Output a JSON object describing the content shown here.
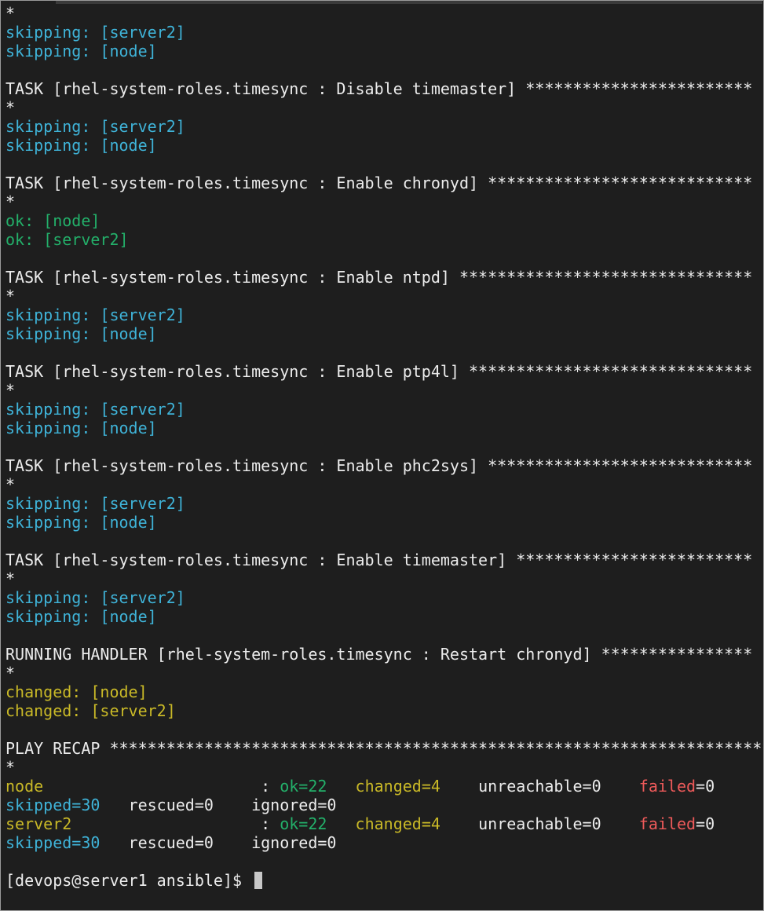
{
  "terminal": {
    "lines": [
      [
        {
          "t": "*",
          "c": "white"
        }
      ],
      [
        {
          "t": "skipping: [server2]",
          "c": "cyan"
        }
      ],
      [
        {
          "t": "skipping: [node]",
          "c": "cyan"
        }
      ],
      [],
      [
        {
          "t": "TASK [rhel-system-roles.timesync : Disable timemaster] ************************",
          "c": "white"
        }
      ],
      [
        {
          "t": "*",
          "c": "white"
        }
      ],
      [
        {
          "t": "skipping: [server2]",
          "c": "cyan"
        }
      ],
      [
        {
          "t": "skipping: [node]",
          "c": "cyan"
        }
      ],
      [],
      [
        {
          "t": "TASK [rhel-system-roles.timesync : Enable chronyd] ****************************",
          "c": "white"
        }
      ],
      [
        {
          "t": "*",
          "c": "white"
        }
      ],
      [
        {
          "t": "ok: [node]",
          "c": "green"
        }
      ],
      [
        {
          "t": "ok: [server2]",
          "c": "green"
        }
      ],
      [],
      [
        {
          "t": "TASK [rhel-system-roles.timesync : Enable ntpd] *******************************",
          "c": "white"
        }
      ],
      [
        {
          "t": "*",
          "c": "white"
        }
      ],
      [
        {
          "t": "skipping: [server2]",
          "c": "cyan"
        }
      ],
      [
        {
          "t": "skipping: [node]",
          "c": "cyan"
        }
      ],
      [],
      [
        {
          "t": "TASK [rhel-system-roles.timesync : Enable ptp4l] ******************************",
          "c": "white"
        }
      ],
      [
        {
          "t": "*",
          "c": "white"
        }
      ],
      [
        {
          "t": "skipping: [server2]",
          "c": "cyan"
        }
      ],
      [
        {
          "t": "skipping: [node]",
          "c": "cyan"
        }
      ],
      [],
      [
        {
          "t": "TASK [rhel-system-roles.timesync : Enable phc2sys] ****************************",
          "c": "white"
        }
      ],
      [
        {
          "t": "*",
          "c": "white"
        }
      ],
      [
        {
          "t": "skipping: [server2]",
          "c": "cyan"
        }
      ],
      [
        {
          "t": "skipping: [node]",
          "c": "cyan"
        }
      ],
      [],
      [
        {
          "t": "TASK [rhel-system-roles.timesync : Enable timemaster] *************************",
          "c": "white"
        }
      ],
      [
        {
          "t": "*",
          "c": "white"
        }
      ],
      [
        {
          "t": "skipping: [server2]",
          "c": "cyan"
        }
      ],
      [
        {
          "t": "skipping: [node]",
          "c": "cyan"
        }
      ],
      [],
      [
        {
          "t": "RUNNING HANDLER [rhel-system-roles.timesync : Restart chronyd] ****************",
          "c": "white"
        }
      ],
      [
        {
          "t": "*",
          "c": "white"
        }
      ],
      [
        {
          "t": "changed: [node]",
          "c": "yellow"
        }
      ],
      [
        {
          "t": "changed: [server2]",
          "c": "yellow"
        }
      ],
      [],
      [
        {
          "t": "PLAY RECAP **********************************************************************",
          "c": "white"
        }
      ],
      [
        {
          "t": "*",
          "c": "white"
        }
      ],
      [
        {
          "t": "node",
          "c": "yellow"
        },
        {
          "t": "                       : ",
          "c": "white"
        },
        {
          "t": "ok=22",
          "c": "green"
        },
        {
          "t": "   ",
          "c": "white"
        },
        {
          "t": "changed=4",
          "c": "yellow"
        },
        {
          "t": "    unreachable=0    ",
          "c": "white"
        },
        {
          "t": "failed",
          "c": "red"
        },
        {
          "t": "=0",
          "c": "white"
        }
      ],
      [
        {
          "t": "skipped=30",
          "c": "cyan"
        },
        {
          "t": "   rescued=0    ignored=0",
          "c": "white"
        }
      ],
      [
        {
          "t": "server2",
          "c": "yellow"
        },
        {
          "t": "                    : ",
          "c": "white"
        },
        {
          "t": "ok=22",
          "c": "green"
        },
        {
          "t": "   ",
          "c": "white"
        },
        {
          "t": "changed=4",
          "c": "yellow"
        },
        {
          "t": "    unreachable=0    ",
          "c": "white"
        },
        {
          "t": "failed",
          "c": "red"
        },
        {
          "t": "=0",
          "c": "white"
        }
      ],
      [
        {
          "t": "skipped=30",
          "c": "cyan"
        },
        {
          "t": "   rescued=0    ignored=0",
          "c": "white"
        }
      ],
      []
    ],
    "prompt": "[devops@server1 ansible]$ ",
    "colors": {
      "background": "#1e1e1e",
      "white": "#ececec",
      "cyan": "#3fb3d8",
      "green": "#23b06a",
      "yellow": "#c9b927",
      "red": "#ef5a5a"
    }
  }
}
